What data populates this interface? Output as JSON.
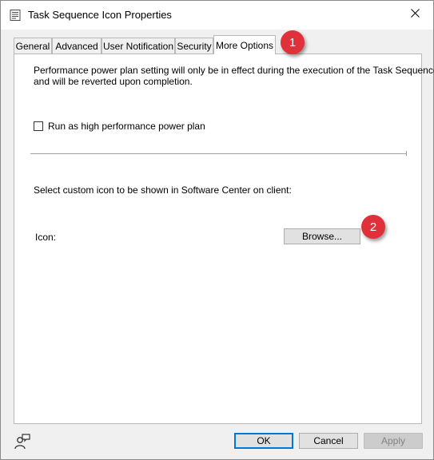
{
  "window": {
    "title": "Task Sequence Icon Properties",
    "title_icon": "properties-window-icon",
    "close_icon": "close-icon"
  },
  "tabs": [
    {
      "label": "General",
      "active": false
    },
    {
      "label": "Advanced",
      "active": false
    },
    {
      "label": "User Notification",
      "active": false
    },
    {
      "label": "Security",
      "active": false
    },
    {
      "label": "More Options",
      "active": true
    }
  ],
  "more_options": {
    "power_note_line1": "Performance power plan setting will only be in effect during the execution of the Task Sequence",
    "power_note_line2": "and will be reverted upon completion.",
    "high_perf_checkbox": {
      "label": "Run as high performance power plan",
      "checked": false
    },
    "icon_section_label": "Select custom icon to be shown in Software Center on client:",
    "icon_label": "Icon:",
    "browse_button": "Browse..."
  },
  "annotations": {
    "badge_1": "1",
    "badge_2": "2",
    "color": "#e0313a"
  },
  "footer": {
    "help_icon": "user-help-icon",
    "ok": "OK",
    "cancel": "Cancel",
    "apply": "Apply",
    "apply_enabled": false
  },
  "colors": {
    "accent": "#0078d7",
    "panel_bg": "#ffffff",
    "dialog_bg": "#f0f0f0"
  }
}
